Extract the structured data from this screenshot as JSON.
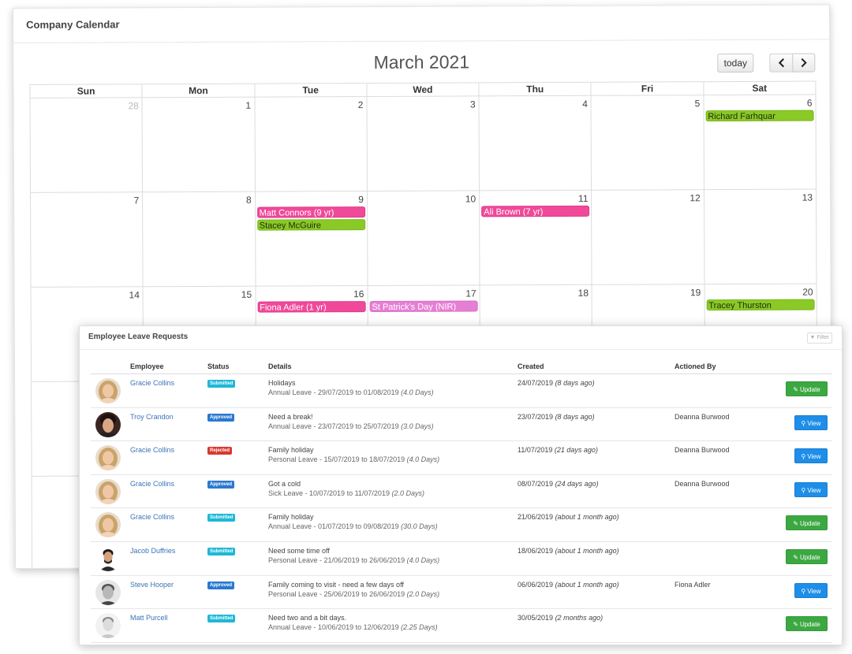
{
  "calendar": {
    "title": "Company Calendar",
    "month_label": "March 2021",
    "today_label": "today",
    "prev_icon": "chevron-left-icon",
    "next_icon": "chevron-right-icon",
    "days_of_week": [
      "Sun",
      "Mon",
      "Tue",
      "Wed",
      "Thu",
      "Fri",
      "Sat"
    ],
    "weeks": [
      [
        {
          "num": "28",
          "other": true,
          "events": []
        },
        {
          "num": "1",
          "events": []
        },
        {
          "num": "2",
          "events": []
        },
        {
          "num": "3",
          "events": []
        },
        {
          "num": "4",
          "events": []
        },
        {
          "num": "5",
          "events": []
        },
        {
          "num": "6",
          "events": [
            {
              "label": "Richard Farhquar",
              "color": "green"
            }
          ]
        }
      ],
      [
        {
          "num": "7",
          "events": []
        },
        {
          "num": "8",
          "events": []
        },
        {
          "num": "9",
          "events": [
            {
              "label": "Matt Connors (9 yr)",
              "color": "pink"
            },
            {
              "label": "Stacey McGuire",
              "color": "green"
            }
          ]
        },
        {
          "num": "10",
          "events": []
        },
        {
          "num": "11",
          "events": [
            {
              "label": "Ali Brown (7 yr)",
              "color": "pink"
            }
          ]
        },
        {
          "num": "12",
          "events": []
        },
        {
          "num": "13",
          "events": []
        }
      ],
      [
        {
          "num": "14",
          "events": []
        },
        {
          "num": "15",
          "events": []
        },
        {
          "num": "16",
          "events": [
            {
              "label": "Fiona Adler (1 yr)",
              "color": "pink"
            }
          ]
        },
        {
          "num": "17",
          "events": [
            {
              "label": "St Patrick's Day (NIR)",
              "color": "orchid"
            }
          ]
        },
        {
          "num": "18",
          "events": []
        },
        {
          "num": "19",
          "events": []
        },
        {
          "num": "20",
          "events": [
            {
              "label": "Tracey Thurston",
              "color": "green"
            }
          ]
        }
      ],
      [
        {
          "num": "",
          "events": []
        },
        {
          "num": "",
          "events": []
        },
        {
          "num": "",
          "events": []
        },
        {
          "num": "",
          "events": []
        },
        {
          "num": "",
          "events": []
        },
        {
          "num": "",
          "events": []
        },
        {
          "num": "",
          "events": []
        }
      ],
      [
        {
          "num": "",
          "events": []
        },
        {
          "num": "",
          "events": []
        },
        {
          "num": "",
          "events": []
        },
        {
          "num": "",
          "events": []
        },
        {
          "num": "",
          "events": []
        },
        {
          "num": "",
          "events": []
        },
        {
          "num": "",
          "events": []
        }
      ]
    ],
    "colors": {
      "green": "#8ac926",
      "pink": "#f0499a",
      "orchid": "#e67ed4"
    }
  },
  "leave": {
    "title": "Employee Leave Requests",
    "filter_label": "Filter",
    "filter_icon": "filter-icon",
    "columns": {
      "employee": "Employee",
      "status": "Status",
      "details": "Details",
      "created": "Created",
      "actioned_by": "Actioned By"
    },
    "rows": [
      {
        "avatar": "gracie",
        "name": "Gracie Collins",
        "status": "Submitted",
        "status_type": "submitted",
        "title": "Holidays",
        "leave": "Annual Leave - 29/07/2019 to 01/08/2019",
        "duration": "(4.0 Days)",
        "created": "24/07/2019",
        "created_ago": "(8 days ago)",
        "actioned_by": "",
        "action": "Update",
        "action_type": "update"
      },
      {
        "avatar": "troy",
        "name": "Troy Crandon",
        "status": "Approved",
        "status_type": "approved",
        "title": "Need a break!",
        "leave": "Annual Leave - 23/07/2019 to 25/07/2019",
        "duration": "(3.0 Days)",
        "created": "23/07/2019",
        "created_ago": "(8 days ago)",
        "actioned_by": "Deanna Burwood",
        "action": "View",
        "action_type": "view"
      },
      {
        "avatar": "gracie",
        "name": "Gracie Collins",
        "status": "Rejected",
        "status_type": "rejected",
        "title": "Family holiday",
        "leave": "Personal Leave - 15/07/2019 to 18/07/2019",
        "duration": "(4.0 Days)",
        "created": "11/07/2019",
        "created_ago": "(21 days ago)",
        "actioned_by": "Deanna Burwood",
        "action": "View",
        "action_type": "view"
      },
      {
        "avatar": "gracie",
        "name": "Gracie Collins",
        "status": "Approved",
        "status_type": "approved",
        "title": "Got a cold",
        "leave": "Sick Leave - 10/07/2019 to 11/07/2019",
        "duration": "(2.0 Days)",
        "created": "08/07/2019",
        "created_ago": "(24 days ago)",
        "actioned_by": "Deanna Burwood",
        "action": "View",
        "action_type": "view"
      },
      {
        "avatar": "gracie",
        "name": "Gracie Collins",
        "status": "Submitted",
        "status_type": "submitted",
        "title": "Family holiday",
        "leave": "Annual Leave - 01/07/2019 to 09/08/2019",
        "duration": "(30.0 Days)",
        "created": "21/06/2019",
        "created_ago": "(about 1 month ago)",
        "actioned_by": "",
        "action": "Update",
        "action_type": "update"
      },
      {
        "avatar": "jacob",
        "name": "Jacob Duffries",
        "status": "Submitted",
        "status_type": "submitted",
        "title": "Need some time off",
        "leave": "Personal Leave - 21/06/2019 to 26/06/2019",
        "duration": "(4.0 Days)",
        "created": "18/06/2019",
        "created_ago": "(about 1 month ago)",
        "actioned_by": "",
        "action": "Update",
        "action_type": "update"
      },
      {
        "avatar": "steve",
        "name": "Steve Hooper",
        "status": "Approved",
        "status_type": "approved",
        "title": "Family coming to visit - need a few days off",
        "leave": "Personal Leave - 25/06/2019 to 26/06/2019",
        "duration": "(2.0 Days)",
        "created": "06/06/2019",
        "created_ago": "(about 1 month ago)",
        "actioned_by": "Fiona Adler",
        "action": "View",
        "action_type": "view"
      },
      {
        "avatar": "matt",
        "name": "Matt Purcell",
        "status": "Submitted",
        "status_type": "submitted",
        "title": "Need two and a bit days.",
        "leave": "Annual Leave - 10/06/2019 to 12/06/2019",
        "duration": "(2.25 Days)",
        "created": "30/05/2019",
        "created_ago": "(2 months ago)",
        "actioned_by": "",
        "action": "Update",
        "action_type": "update"
      }
    ],
    "icons": {
      "update": "edit-icon",
      "view": "search-icon"
    }
  }
}
